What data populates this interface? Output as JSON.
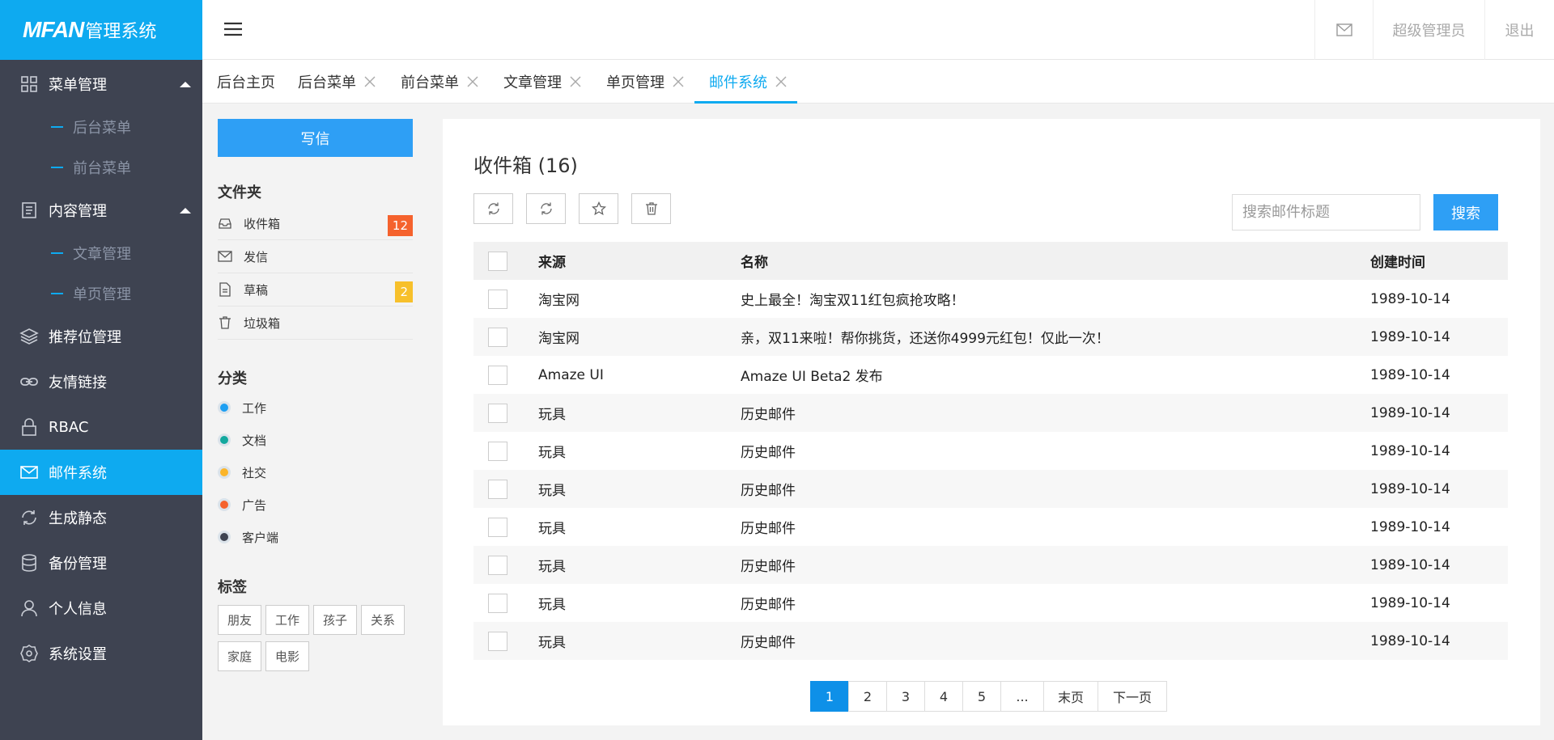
{
  "logo": {
    "mark": "MFAN",
    "text": "管理系统"
  },
  "sidebar": {
    "items": [
      {
        "label": "菜单管理",
        "icon": "grid-icon",
        "expanded": true,
        "children": [
          {
            "label": "后台菜单"
          },
          {
            "label": "前台菜单"
          }
        ]
      },
      {
        "label": "内容管理",
        "icon": "document-icon",
        "expanded": true,
        "children": [
          {
            "label": "文章管理"
          },
          {
            "label": "单页管理"
          }
        ]
      },
      {
        "label": "推荐位管理",
        "icon": "layers-icon"
      },
      {
        "label": "友情链接",
        "icon": "link-icon"
      },
      {
        "label": "RBAC",
        "icon": "lock-icon"
      },
      {
        "label": "邮件系统",
        "icon": "mail-icon",
        "active": true
      },
      {
        "label": "生成静态",
        "icon": "refresh-icon"
      },
      {
        "label": "备份管理",
        "icon": "database-icon"
      },
      {
        "label": "个人信息",
        "icon": "user-icon"
      },
      {
        "label": "系统设置",
        "icon": "gear-icon"
      }
    ]
  },
  "header": {
    "user": "超级管理员",
    "logout": "退出"
  },
  "tabs": [
    {
      "label": "后台主页",
      "closable": false
    },
    {
      "label": "后台菜单",
      "closable": true
    },
    {
      "label": "前台菜单",
      "closable": true
    },
    {
      "label": "文章管理",
      "closable": true
    },
    {
      "label": "单页管理",
      "closable": true
    },
    {
      "label": "邮件系统",
      "closable": true,
      "active": true
    }
  ],
  "mail_left": {
    "compose": "写信",
    "folders_title": "文件夹",
    "folders": [
      {
        "label": "收件箱",
        "icon": "inbox-icon",
        "badge": "12",
        "badge_color": "#f5622d"
      },
      {
        "label": "发信",
        "icon": "envelope-icon"
      },
      {
        "label": "草稿",
        "icon": "draft-icon",
        "badge": "2",
        "badge_color": "#f7c02b"
      },
      {
        "label": "垃圾箱",
        "icon": "trash-icon"
      }
    ],
    "categories_title": "分类",
    "categories": [
      {
        "label": "工作",
        "color": "#1e9ff2"
      },
      {
        "label": "文档",
        "color": "#13a89e"
      },
      {
        "label": "社交",
        "color": "#fbb52a"
      },
      {
        "label": "广告",
        "color": "#f5622d"
      },
      {
        "label": "客户端",
        "color": "#3e4351"
      }
    ],
    "tags_title": "标签",
    "tags": [
      "朋友",
      "工作",
      "孩子",
      "关系",
      "家庭",
      "电影"
    ]
  },
  "mail_main": {
    "title": "收件箱 (16)",
    "search_placeholder": "搜索邮件标题",
    "search_button": "搜索",
    "columns": {
      "source": "来源",
      "name": "名称",
      "created": "创建时间"
    },
    "rows": [
      {
        "source": "淘宝网",
        "name": "史上最全！淘宝双11红包疯抢攻略！",
        "created": "1989-10-14"
      },
      {
        "source": "淘宝网",
        "name": "亲，双11来啦！帮你挑货，还送你4999元红包！仅此一次！",
        "created": "1989-10-14"
      },
      {
        "source": "Amaze UI",
        "name": "Amaze UI Beta2 发布",
        "created": "1989-10-14"
      },
      {
        "source": "玩具",
        "name": "历史邮件",
        "created": "1989-10-14"
      },
      {
        "source": "玩具",
        "name": "历史邮件",
        "created": "1989-10-14"
      },
      {
        "source": "玩具",
        "name": "历史邮件",
        "created": "1989-10-14"
      },
      {
        "source": "玩具",
        "name": "历史邮件",
        "created": "1989-10-14"
      },
      {
        "source": "玩具",
        "name": "历史邮件",
        "created": "1989-10-14"
      },
      {
        "source": "玩具",
        "name": "历史邮件",
        "created": "1989-10-14"
      },
      {
        "source": "玩具",
        "name": "历史邮件",
        "created": "1989-10-14"
      }
    ],
    "pagination": [
      {
        "label": "1",
        "active": true
      },
      {
        "label": "2"
      },
      {
        "label": "3"
      },
      {
        "label": "4"
      },
      {
        "label": "5"
      },
      {
        "label": "..."
      },
      {
        "label": "末页"
      },
      {
        "label": "下一页"
      }
    ]
  }
}
